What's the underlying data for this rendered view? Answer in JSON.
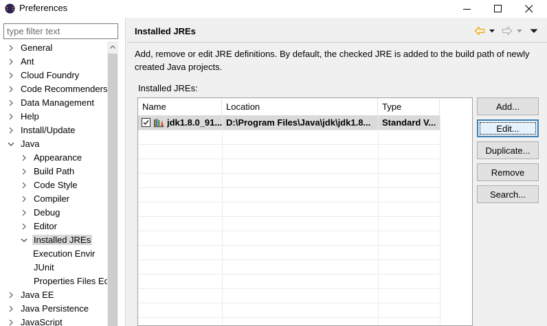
{
  "window": {
    "title": "Preferences",
    "controls": {
      "minimize": "minimize-icon",
      "maximize": "maximize-icon",
      "close": "close-icon"
    }
  },
  "sidebar": {
    "filter_placeholder": "type filter text",
    "items": [
      {
        "label": "General",
        "level": 0,
        "expanded": false,
        "has_children": true,
        "selected": false
      },
      {
        "label": "Ant",
        "level": 0,
        "expanded": false,
        "has_children": true,
        "selected": false
      },
      {
        "label": "Cloud Foundry",
        "level": 0,
        "expanded": false,
        "has_children": true,
        "selected": false
      },
      {
        "label": "Code Recommenders",
        "level": 0,
        "expanded": false,
        "has_children": true,
        "selected": false
      },
      {
        "label": "Data Management",
        "level": 0,
        "expanded": false,
        "has_children": true,
        "selected": false
      },
      {
        "label": "Help",
        "level": 0,
        "expanded": false,
        "has_children": true,
        "selected": false
      },
      {
        "label": "Install/Update",
        "level": 0,
        "expanded": false,
        "has_children": true,
        "selected": false
      },
      {
        "label": "Java",
        "level": 0,
        "expanded": true,
        "has_children": true,
        "selected": false
      },
      {
        "label": "Appearance",
        "level": 1,
        "expanded": false,
        "has_children": true,
        "selected": false
      },
      {
        "label": "Build Path",
        "level": 1,
        "expanded": false,
        "has_children": true,
        "selected": false
      },
      {
        "label": "Code Style",
        "level": 1,
        "expanded": false,
        "has_children": true,
        "selected": false
      },
      {
        "label": "Compiler",
        "level": 1,
        "expanded": false,
        "has_children": true,
        "selected": false
      },
      {
        "label": "Debug",
        "level": 1,
        "expanded": false,
        "has_children": true,
        "selected": false
      },
      {
        "label": "Editor",
        "level": 1,
        "expanded": false,
        "has_children": true,
        "selected": false
      },
      {
        "label": "Installed JREs",
        "level": 1,
        "expanded": true,
        "has_children": true,
        "selected": true
      },
      {
        "label": "Execution Envir",
        "level": 2,
        "expanded": false,
        "has_children": false,
        "selected": false
      },
      {
        "label": "JUnit",
        "level": 1,
        "expanded": false,
        "has_children": false,
        "selected": false
      },
      {
        "label": "Properties Files Ed",
        "level": 1,
        "expanded": false,
        "has_children": false,
        "selected": false
      },
      {
        "label": "Java EE",
        "level": 0,
        "expanded": false,
        "has_children": true,
        "selected": false
      },
      {
        "label": "Java Persistence",
        "level": 0,
        "expanded": false,
        "has_children": true,
        "selected": false
      },
      {
        "label": "JavaScript",
        "level": 0,
        "expanded": false,
        "has_children": true,
        "selected": false
      }
    ]
  },
  "page": {
    "title": "Installed JREs",
    "description": "Add, remove or edit JRE definitions. By default, the checked JRE is added to the build path of newly created Java projects.",
    "list_label": "Installed JREs:",
    "nav_icons": [
      "back-arrow-icon",
      "forward-arrow-icon",
      "view-menu-icon"
    ]
  },
  "table": {
    "columns": [
      "Name",
      "Location",
      "Type"
    ],
    "rows": [
      {
        "checked": true,
        "name": "jdk1.8.0_91...",
        "location": "D:\\Program Files\\Java\\jdk\\jdk1.8...",
        "type": "Standard V...",
        "selected": true,
        "bold": true
      }
    ]
  },
  "buttons": {
    "add": "Add...",
    "edit": "Edit...",
    "duplicate": "Duplicate...",
    "remove": "Remove",
    "search": "Search..."
  },
  "colors": {
    "selection": "#dadada",
    "panel_bg": "#f0f0f0",
    "back_arrow": "#e6a817",
    "focus_border": "#3c7fb1"
  }
}
